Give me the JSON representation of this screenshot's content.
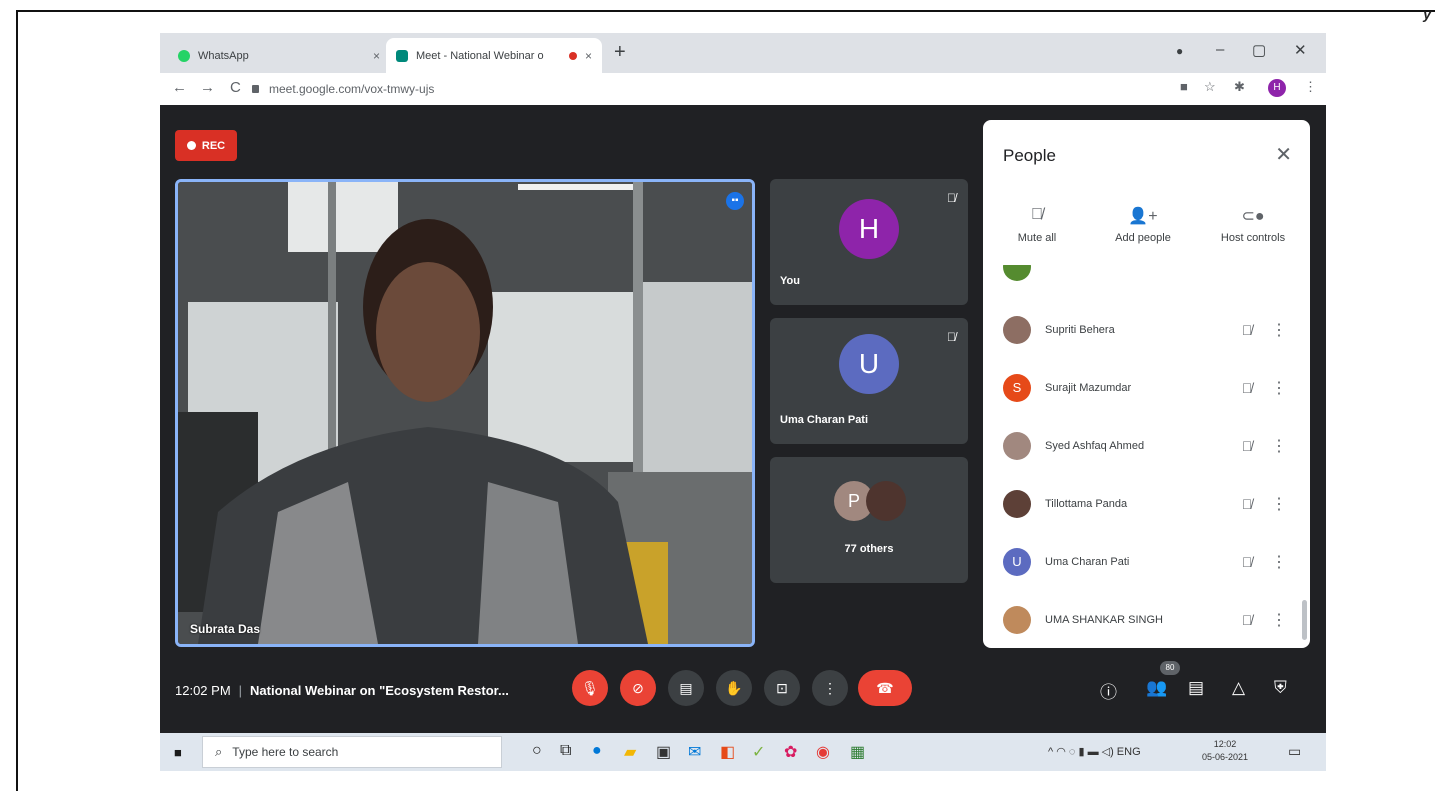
{
  "corner_mark": "y",
  "browser": {
    "tabs": [
      {
        "title": "WhatsApp",
        "close": "×"
      },
      {
        "title": "Meet - National Webinar o",
        "close": "×"
      }
    ],
    "new_tab": "+",
    "window_controls": [
      "–",
      "▢",
      "✕"
    ],
    "url": "meet.google.com/vox-tmwy-ujs",
    "profile_initial": "H",
    "nav": {
      "back": "←",
      "forward": "→",
      "reload": "C"
    }
  },
  "meet": {
    "rec_label": "REC",
    "main_speaker": "Subrata Das",
    "tiles": [
      {
        "initial": "H",
        "name": "You",
        "color": "#8e24aa"
      },
      {
        "initial": "U",
        "name": "Uma Charan Pati",
        "color": "#5c6bc0"
      },
      {
        "initial": "P",
        "name": "77 others",
        "color": "#a1887f"
      }
    ],
    "time": "12:02 PM",
    "meeting_title": "National Webinar on \"Ecosystem Restor...",
    "participant_count": "80",
    "colors": {
      "accent": "#1a73e8",
      "danger": "#ea4335",
      "speaking_border": "#8ab4f8"
    }
  },
  "people_panel": {
    "title": "People",
    "close": "✕",
    "actions": [
      {
        "label": "Mute all",
        "icon": "mic-off-icon"
      },
      {
        "label": "Add people",
        "icon": "add-person-icon"
      },
      {
        "label": "Host controls",
        "icon": "toggle-icon"
      }
    ],
    "participants": [
      {
        "name": "Supriti Behera",
        "initial": "",
        "color": "#8d6e63"
      },
      {
        "name": "Surajit Mazumdar",
        "initial": "S",
        "color": "#e64a19"
      },
      {
        "name": "Syed Ashfaq Ahmed",
        "initial": "",
        "color": "#a1887f"
      },
      {
        "name": "Tillottama Panda",
        "initial": "",
        "color": "#5d4037"
      },
      {
        "name": "Uma Charan Pati",
        "initial": "U",
        "color": "#5c6bc0"
      },
      {
        "name": "UMA SHANKAR SINGH",
        "initial": "",
        "color": "#bf8a5c"
      }
    ]
  },
  "taskbar": {
    "search_placeholder": "Type here to search",
    "tray": "^ ◠ ◌ ▮ ▬ ◁) ENG",
    "clock_time": "12:02",
    "clock_date": "05-06-2021"
  }
}
